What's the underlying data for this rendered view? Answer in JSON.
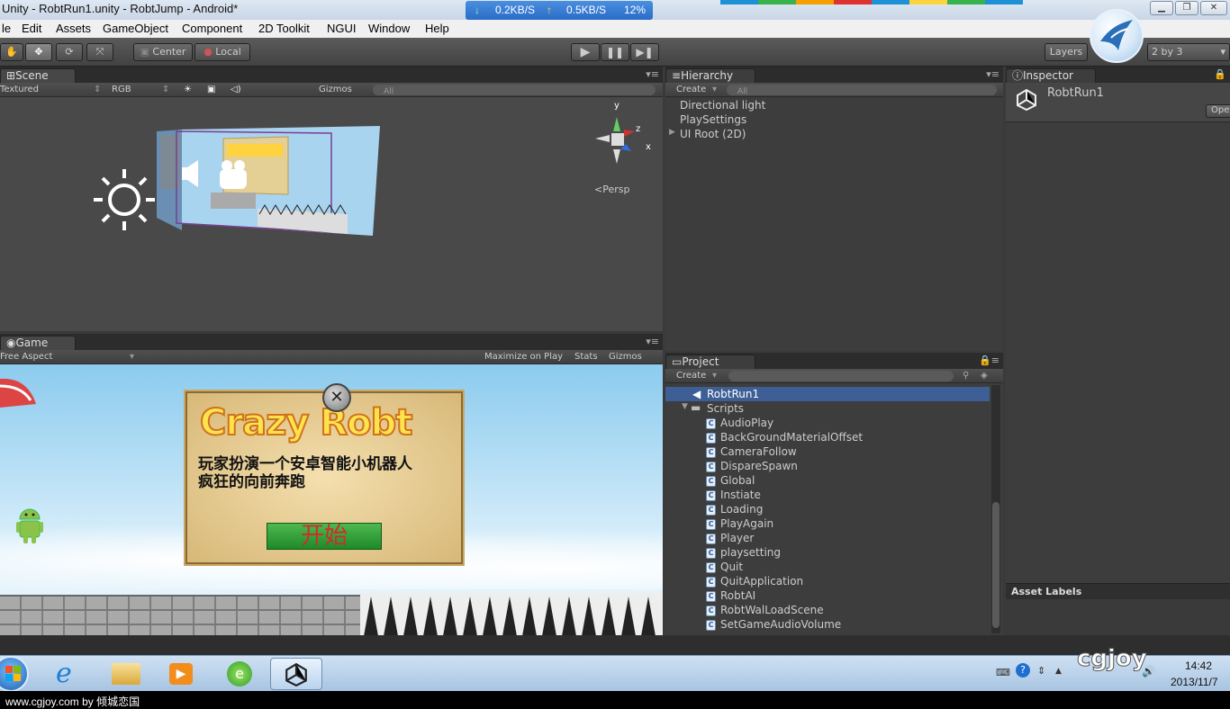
{
  "window": {
    "title": "Unity - RobtRun1.unity - RobtJump - Android*",
    "net_down": "0.2KB/S",
    "net_up": "0.5KB/S",
    "cpu": "12%"
  },
  "menu": [
    "le",
    "Edit",
    "Assets",
    "GameObject",
    "Component",
    "2D Toolkit",
    "NGUI",
    "Window",
    "Help"
  ],
  "toolbar": {
    "pivot_label": "Center",
    "space_label": "Local",
    "layers_label": "Layers",
    "layout_label": "2 by 3"
  },
  "scene": {
    "tab_label": "Scene",
    "render_mode": "Textured",
    "color_mode": "RGB",
    "gizmos_label": "Gizmos",
    "search_placeholder": "All",
    "persp_label": "Persp",
    "axis_y": "y",
    "axis_z": "z",
    "axis_x": "x"
  },
  "game": {
    "tab_label": "Game",
    "aspect": "Free Aspect",
    "maximize_label": "Maximize on Play",
    "stats_label": "Stats",
    "gizmos_label": "Gizmos",
    "logo_text": "Crazy Robt",
    "description_line1": "玩家扮演一个安卓智能小机器人",
    "description_line2": "疯狂的向前奔跑",
    "start_label": "开始"
  },
  "hierarchy": {
    "tab_label": "Hierarchy",
    "create_label": "Create",
    "search_placeholder": "All",
    "items": [
      "Directional light",
      "PlaySettings",
      "UI Root (2D)"
    ]
  },
  "project": {
    "tab_label": "Project",
    "create_label": "Create",
    "scene_item": "RobtRun1",
    "folder": "Scripts",
    "scripts": [
      "AudioPlay",
      "BackGroundMaterialOffset",
      "CameraFollow",
      "DispareSpawn",
      "Global",
      "Instiate",
      "Loading",
      "PlayAgain",
      "Player",
      "playsetting",
      "Quit",
      "QuitApplication",
      "RobtAI",
      "RobtWalLoadScene",
      "SetGameAudioVolume"
    ]
  },
  "inspector": {
    "tab_label": "Inspector",
    "object_name": "RobtRun1",
    "open_label": "Ope",
    "asset_labels": "Asset Labels"
  },
  "taskbar": {
    "time": "14:42",
    "date": "2013/11/7",
    "watermark": "cgjoy"
  },
  "footer": {
    "text": "www.cgjoy.com by 倾城恋国"
  }
}
